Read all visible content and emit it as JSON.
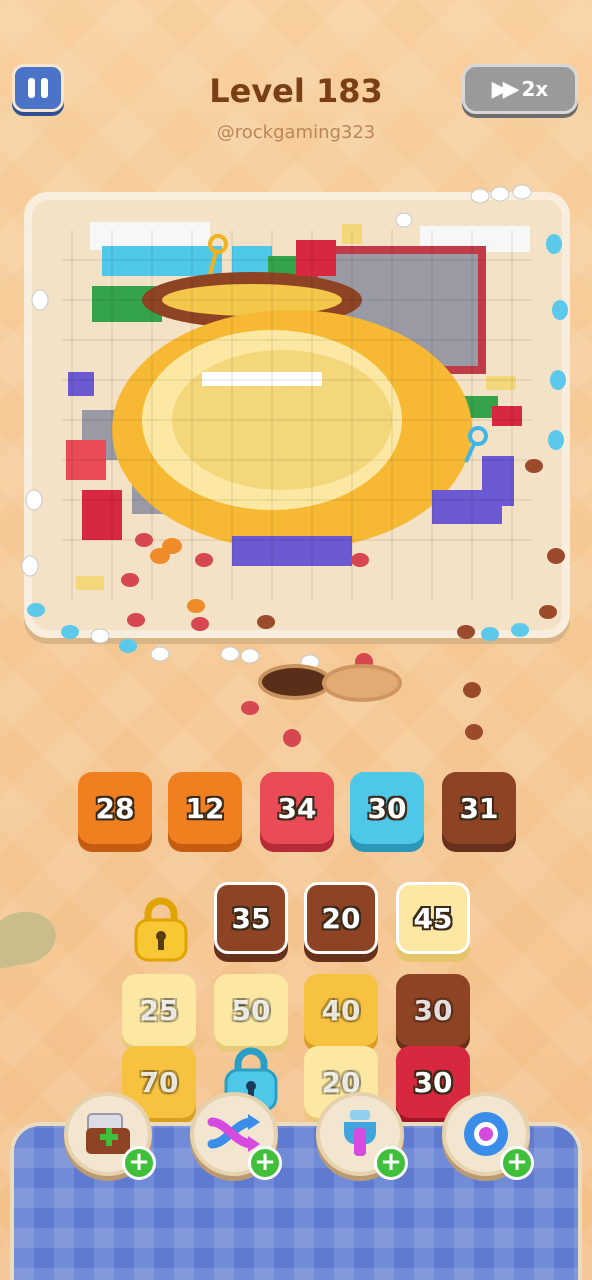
{
  "header": {
    "level_title": "Level 183",
    "watermark": "@rockgaming323",
    "speed_label": "2x"
  },
  "icons": {
    "pause": "pause-icon",
    "fast_forward": "fast-forward-icon",
    "lock": "padlock-icon",
    "key": "key-icon",
    "plus": "plus-icon"
  },
  "colors": {
    "orange": "#f07f1f",
    "red": "#e94b57",
    "cyan": "#4fc7e8",
    "brown": "#8e4424",
    "pale_yellow": "#fce8a3",
    "yellow": "#f6c240",
    "crimson": "#d8283f",
    "dock_blue": "#5f7bd0"
  },
  "queue": [
    {
      "value": "28",
      "color": "orange"
    },
    {
      "value": "12",
      "color": "orange"
    },
    {
      "value": "34",
      "color": "red"
    },
    {
      "value": "30",
      "color": "cyan"
    },
    {
      "value": "31",
      "color": "brown"
    }
  ],
  "grid": {
    "row1": [
      {
        "value": "35",
        "color": "brown"
      },
      {
        "value": "20",
        "color": "brown"
      },
      {
        "value": "45",
        "color": "pale_yellow"
      }
    ],
    "row2": [
      {
        "value": "25",
        "color": "pale_yellow"
      },
      {
        "value": "50",
        "color": "pale_yellow"
      },
      {
        "value": "40",
        "color": "yellow"
      },
      {
        "value": "30",
        "color": "brown"
      }
    ],
    "row3": [
      {
        "value": "70",
        "color": "yellow"
      },
      {
        "value": "20",
        "color": "pale_yellow"
      },
      {
        "value": "30",
        "color": "crimson"
      }
    ]
  },
  "boosters": [
    {
      "name": "add-tray-booster"
    },
    {
      "name": "shuffle-booster"
    },
    {
      "name": "magnet-claw-booster"
    },
    {
      "name": "disc-booster"
    }
  ]
}
